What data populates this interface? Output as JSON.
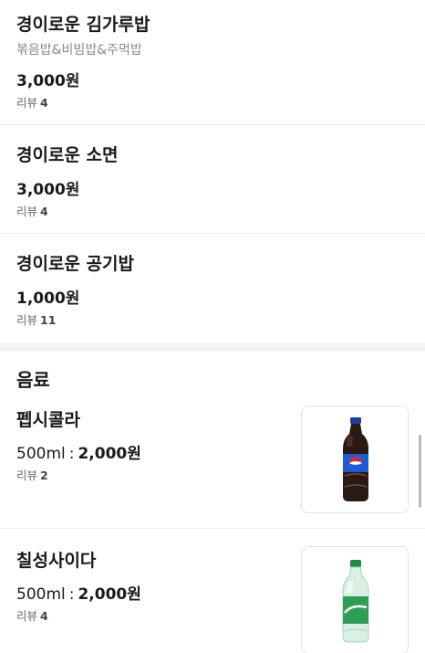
{
  "items": [
    {
      "name": "경이로운 김가루밥",
      "desc": "볶음밥&비빔밥&주먹밥",
      "price": "3,000원",
      "review_label": "리뷰",
      "review_count": "4"
    },
    {
      "name": "경이로운 소면",
      "price": "3,000원",
      "review_label": "리뷰",
      "review_count": "4"
    },
    {
      "name": "경이로운 공기밥",
      "price": "1,000원",
      "review_label": "리뷰",
      "review_count": "11"
    }
  ],
  "drinks_section": {
    "title": "음료",
    "items": [
      {
        "name": "펩시콜라",
        "size": "500ml",
        "separator": ":",
        "price": "2,000원",
        "review_label": "리뷰",
        "review_count": "2",
        "image_icon": "pepsi-bottle-icon",
        "bottle_color": "#2a1a14",
        "label_color": "#1a5bd6"
      },
      {
        "name": "칠성사이다",
        "size": "500ml",
        "separator": ":",
        "price": "2,000원",
        "review_label": "리뷰",
        "review_count": "4",
        "image_icon": "chilsung-bottle-icon",
        "bottle_color": "#d8efe2",
        "label_color": "#2e9e55"
      }
    ]
  }
}
